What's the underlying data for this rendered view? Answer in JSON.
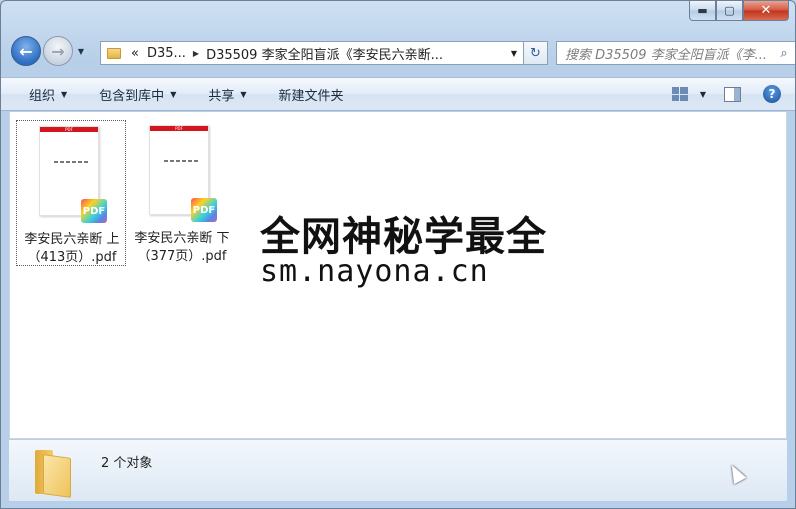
{
  "window": {
    "minimize_glyph": "▬",
    "maximize_glyph": "▢",
    "close_glyph": "✕"
  },
  "nav": {
    "back_glyph": "←",
    "forward_glyph": "→",
    "address": {
      "overflow": "«",
      "segment1": "D35...",
      "segment2": "D35509 李家全阳盲派《李安民六亲断..."
    },
    "search_placeholder": "搜索 D35509 李家全阳盲派《李..."
  },
  "toolbar": {
    "organize": "组织",
    "include_in_library": "包含到库中",
    "share": "共享",
    "new_folder": "新建文件夹",
    "help_glyph": "?"
  },
  "files": [
    {
      "name_line1": "李安民六亲断 上",
      "name_line2": "（413页）.pdf",
      "badge": "PDF",
      "band": "PDF",
      "selected": true
    },
    {
      "name_line1": "李安民六亲断 下",
      "name_line2": "（377页）.pdf",
      "badge": "PDF",
      "band": "PDF",
      "selected": false
    }
  ],
  "watermark": {
    "line1": "全网神秘学最全",
    "line2": "sm.nayona.cn"
  },
  "details": {
    "count": "2 个对象"
  },
  "colors": {
    "pdf_band": "#d4161c",
    "chrome": "#b9d1ea"
  }
}
